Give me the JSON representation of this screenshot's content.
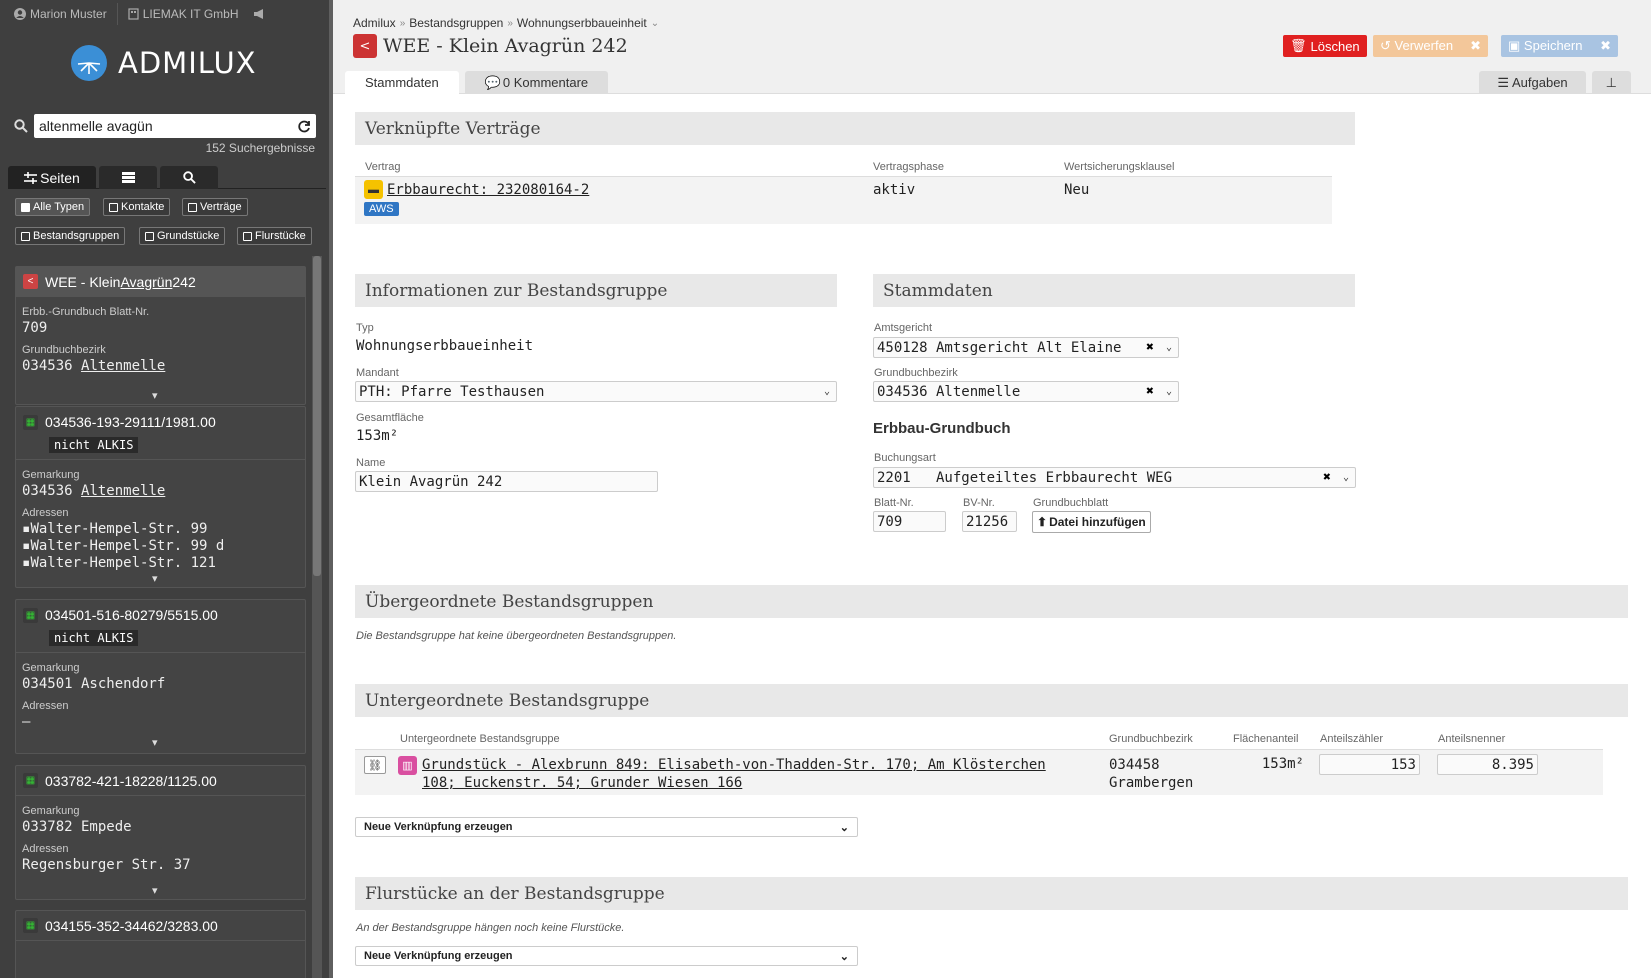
{
  "sidebar": {
    "user": "Marion Muster",
    "company": "LIEMAK IT GmbH",
    "logo_text": "ADMILUX",
    "search_value": "altenmelle avagün",
    "hits": "152 Suchergebnisse",
    "tabs": {
      "pages": "Seiten"
    },
    "filters": [
      "Alle Typen",
      "Kontakte",
      "Verträge",
      "Bestandsgruppen",
      "Grundstücke",
      "Flurstücke"
    ],
    "cards": [
      {
        "title_pre": "WEE - Klein ",
        "title_link": "Avagrün",
        "title_post": " 242",
        "l1": "Erbb.-Grundbuch Blatt-Nr.",
        "v1": "709",
        "l2": "Grundbuchbezirk",
        "v2_pre": "034536 ",
        "v2_link": "Altenmelle"
      },
      {
        "title": "034536-193-29111/1981.00",
        "badge": "nicht ALKIS",
        "l1": "Gemarkung",
        "v1_pre": "034536 ",
        "v1_link": "Altenmelle",
        "l2": "Adressen",
        "addr": [
          "Walter-Hempel-Str. 99",
          "Walter-Hempel-Str. 99 d",
          "Walter-Hempel-Str. 121"
        ]
      },
      {
        "title": "034501-516-80279/5515.00",
        "badge": "nicht ALKIS",
        "l1": "Gemarkung",
        "v1": "034501 Aschendorf",
        "l2": "Adressen",
        "v2": "–"
      },
      {
        "title": "033782-421-18228/1125.00",
        "l1": "Gemarkung",
        "v1": "033782 Empede",
        "l2": "Adressen",
        "v2": "Regensburger Str. 37"
      },
      {
        "title": "034155-352-34462/3283.00"
      }
    ]
  },
  "header": {
    "breadcrumb": [
      "Admilux",
      "Bestandsgruppen",
      "Wohnungserbbaueinheit"
    ],
    "title": "WEE - Klein Avagrün 242",
    "btn_delete": "Löschen",
    "btn_discard": "Verwerfen",
    "btn_save": "Speichern",
    "tab_main": "Stammdaten",
    "tab_comments": "0 Kommentare",
    "tab_tasks": "Aufgaben"
  },
  "contracts": {
    "heading": "Verknüpfte Verträge",
    "cols": [
      "Vertrag",
      "Vertragsphase",
      "Wertsicherungsklausel"
    ],
    "row": {
      "contract": "Erbbaurecht: 232080164-2",
      "tag": "AWS",
      "phase": "aktiv",
      "clause": "Neu"
    }
  },
  "info": {
    "heading": "Informationen zur Bestandsgruppe",
    "typ_label": "Typ",
    "typ": "Wohnungserbbaueinheit",
    "mandant_label": "Mandant",
    "mandant": "PTH: Pfarre Testhausen",
    "flaeche_label": "Gesamtfläche",
    "flaeche": "153m²",
    "name_label": "Name",
    "name": "Klein Avagrün 242"
  },
  "stamm": {
    "heading": "Stammdaten",
    "amtsgericht_label": "Amtsgericht",
    "amtsgericht": "450128 Amtsgericht Alt Elaine",
    "bezirk_label": "Grundbuchbezirk",
    "bezirk": "034536 Altenmelle",
    "erbbau_heading": "Erbbau-Grundbuch",
    "buchungsart_label": "Buchungsart",
    "buchungsart": "2201   Aufgeteiltes Erbbaurecht WEG",
    "blatt_label": "Blatt-Nr.",
    "blatt": "709",
    "bv_label": "BV-Nr.",
    "bv": "21256",
    "gb_label": "Grundbuchblatt",
    "gb_btn": "Datei hinzufügen"
  },
  "parent": {
    "heading": "Übergeordnete Bestandsgruppen",
    "note": "Die Bestandsgruppe hat keine übergeordneten Bestandsgruppen."
  },
  "children": {
    "heading": "Untergeordnete Bestandsgruppe",
    "cols": [
      "Untergeordnete Bestandsgruppe",
      "Grundbuchbezirk",
      "Flächenanteil",
      "Anteilszähler",
      "Anteilsnenner"
    ],
    "row": {
      "name_1": "Grundstück - Alexbrunn 849: Elisabeth-von-Thadden-Str. 170; Am Klösterchen",
      "name_2": "108; Euckenstr. 54; Grunder Wiesen 166",
      "bezirk_1": "034458",
      "bezirk_2": "Grambergen",
      "flaeche": "153m²",
      "zaehler": "153",
      "nenner": "8.395"
    },
    "new_link": "Neue Verknüpfung erzeugen"
  },
  "parcels": {
    "heading": "Flurstücke an der Bestandsgruppe",
    "note": "An der Bestandsgruppe hängen noch keine Flurstücke.",
    "new_link": "Neue Verknüpfung erzeugen"
  }
}
